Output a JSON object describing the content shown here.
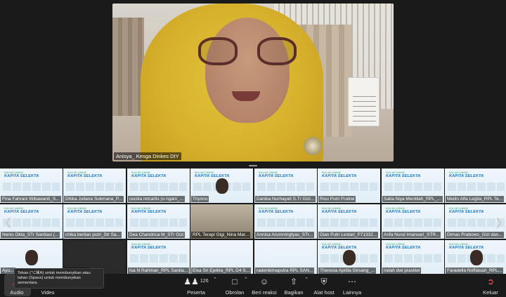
{
  "speaker": {
    "name": "Anisya_ Kesga Dinkes DIY"
  },
  "tile_brand": {
    "line1": "KULIAH UMUM",
    "line2": "KAPITA SELEKTA"
  },
  "gallery_rows": [
    [
      "Fina Fahrani Wibawanti_S...",
      "Dhika Juliana Sukmana_P...",
      "cecilia retcarlis (u ngani_...",
      "Triyono",
      "Danika Nurhayati S.Tr Gizi...",
      "Rosi Putri Pratiwi",
      "Salta Niya Merdilah_RPL_...",
      "Meilin Alfa Legita_RPL Te..."
    ],
    [
      "Nenis Okta_STr Sanitasi (...",
      "chika berlian putri_Str Sa...",
      "Dea Chandrica M_STr Gizi",
      "RPL Terapi Gigi_Nina Mar...",
      "Annisa Arumningtyas_STr...",
      "Dian Putri Lestari_P71332...",
      "Arifa Nurul Imansari_STR...",
      "Dimas Prabowo_Gizi dan..."
    ],
    [
      "Ayu...",
      "...uningrum",
      "Isa N Rahman_RPL Sanita...",
      "Elsa Sri Ejelika_RPL D4 S...",
      "radenbimaputra RPL SAN...",
      "Theresia Aprilia Girsang_...",
      "indah dwi prastiwi",
      "Faradella Nofitasari_RPL..."
    ]
  ],
  "tooltip": "Tekan (⌥⌘A) untuk membunyikan atau tahan (Space) untuk membunyikan sementara.",
  "toolbar": {
    "audio": "Audio",
    "video": "Video",
    "participants": "Peserta",
    "participants_count": "126",
    "chat": "Obrolan",
    "reactions": "Beri reaksi",
    "share": "Bagikan",
    "host_tools": "Alat host",
    "more": "Lainnya",
    "leave": "Keluar"
  }
}
